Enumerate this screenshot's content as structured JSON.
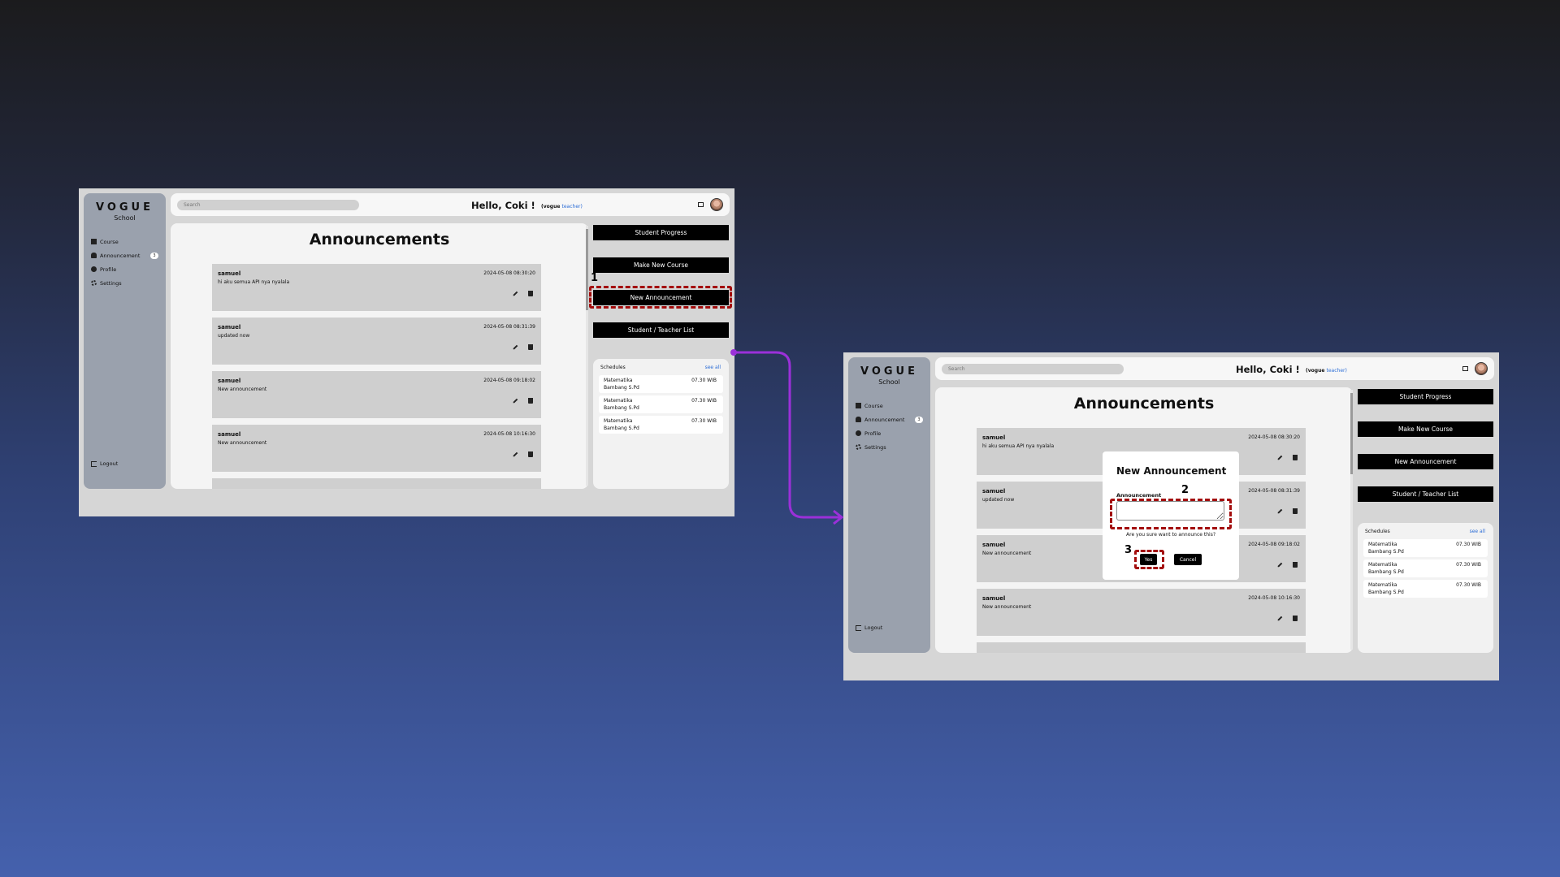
{
  "app": {
    "logo_title": "VOGUE",
    "logo_subtitle": "School",
    "nav": [
      {
        "label": "Course",
        "icon": "book-icon"
      },
      {
        "label": "Announcement",
        "icon": "bell-icon",
        "badge": "3"
      },
      {
        "label": "Profile",
        "icon": "user-circle-icon"
      },
      {
        "label": "Settings",
        "icon": "gear-icon"
      }
    ],
    "logout_label": "Logout",
    "search_placeholder": "Search",
    "greeting": "Hello, Coki !",
    "role_brand": "(vogue",
    "role_name": "teacher)",
    "page_title": "Announcements"
  },
  "announcements": [
    {
      "author": "samuel",
      "text": "hi aku semua API nya nyalala",
      "date": "2024-05-08 08:30:20"
    },
    {
      "author": "samuel",
      "text": "updated now",
      "date": "2024-05-08 08:31:39"
    },
    {
      "author": "samuel",
      "text": "New announcement",
      "date": "2024-05-08 09:18:02"
    },
    {
      "author": "samuel",
      "text": "New announcement",
      "date": "2024-05-08 10:16:30"
    }
  ],
  "actions": {
    "student_progress": "Student Progress",
    "make_new_course": "Make New Course",
    "new_announcement": "New Announcement",
    "student_teacher_list": "Student / Teacher List"
  },
  "schedules": {
    "title": "Schedules",
    "see_all": "see all",
    "items": [
      {
        "subject": "Matematika",
        "teacher": "Bambang S.Pd",
        "time": "07.30 WIB"
      },
      {
        "subject": "Matematika",
        "teacher": "Bambang S.Pd",
        "time": "07.30 WIB"
      },
      {
        "subject": "Matematika",
        "teacher": "Bambang S.Pd",
        "time": "07.30 WIB"
      }
    ]
  },
  "modal": {
    "title": "New Announcement",
    "field_label": "Announcement",
    "confirm_text": "Are you sure want to announce this?",
    "yes_label": "Yes",
    "cancel_label": "Cancel"
  },
  "steps": {
    "step1": "1",
    "step2": "2",
    "step3": "3"
  },
  "colors": {
    "highlight": "#a30d0d",
    "arrow": "#9b30d9",
    "link": "#2c6dd6"
  }
}
